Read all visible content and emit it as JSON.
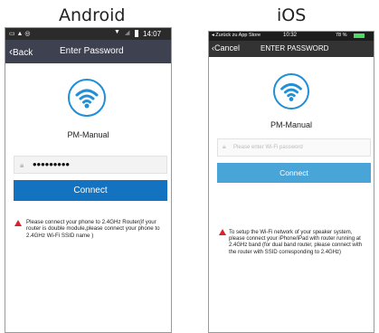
{
  "labels": {
    "android": "Android",
    "ios": "iOS"
  },
  "colors": {
    "android_button": "#1373c0",
    "ios_button": "#49a4d8",
    "wifi_blue": "#1f8fd6",
    "warning_red": "#d9222a"
  },
  "android": {
    "status_time": "14:07",
    "back_label": "Back",
    "title": "Enter Password",
    "app_name": "PM-Manual",
    "password_value": "•••••••••",
    "connect_label": "Connect",
    "warning_text": "Please connect your phone to 2.4GHz Router(if your router is double module,please connect your phone to 2.4GHz Wi-Fi SSID name )"
  },
  "ios": {
    "status_back_app": "◂ Zurück zu App Store",
    "status_time": "10:32",
    "status_battery": "78 %",
    "cancel_label": "Cancel",
    "title": "ENTER PASSWORD",
    "app_name": "PM-Manual",
    "password_placeholder": "Please enter Wi-Fi password",
    "connect_label": "Connect",
    "warning_text": "To setup the Wi-Fi network of your speaker system, please connect your iPhone/iPad with router running at 2.4GHz band (for dual band router, please connect with the router with SSID corresponding to 2.4GHz)"
  }
}
